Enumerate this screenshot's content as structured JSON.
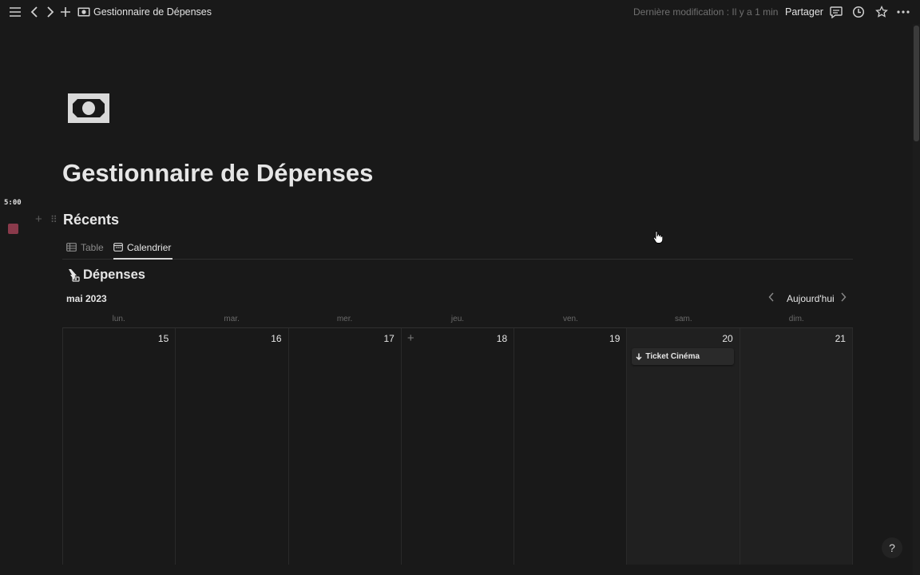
{
  "topbar": {
    "page_title": "Gestionnaire de Dépenses",
    "last_modified": "Dernière modification : Il y a 1 min",
    "share_label": "Partager"
  },
  "page": {
    "title": "Gestionnaire de Dépenses",
    "icon": "money-bill-icon"
  },
  "sidebar_overlay": {
    "timer": "5:00",
    "accent_color": "#8a3a4b"
  },
  "section": {
    "title": "Récents"
  },
  "views": {
    "tabs": [
      {
        "label": "Table",
        "active": false
      },
      {
        "label": "Calendrier",
        "active": true
      }
    ]
  },
  "database": {
    "title": "Dépenses"
  },
  "calendar": {
    "month": "mai 2023",
    "today_label": "Aujourd'hui",
    "weekdays": [
      "lun.",
      "mar.",
      "mer.",
      "jeu.",
      "ven.",
      "sam.",
      "dim."
    ],
    "days": [
      "15",
      "16",
      "17",
      "18",
      "19",
      "20",
      "21"
    ],
    "events": [
      {
        "day": "20",
        "title": "Ticket Cinéma"
      }
    ]
  },
  "help_label": "?"
}
